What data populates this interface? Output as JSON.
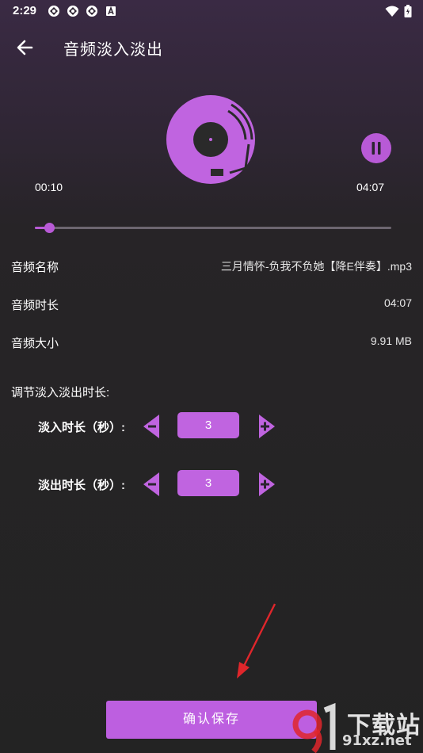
{
  "statusbar": {
    "time": "2:29",
    "icons": [
      "app-notification-icon",
      "app-notification-icon",
      "app-notification-icon",
      "font-a-icon"
    ],
    "right_icons": [
      "wifi-icon",
      "battery-icon"
    ]
  },
  "header": {
    "title": "音频淡入淡出",
    "back_icon": "back-arrow-icon"
  },
  "player": {
    "current_time": "00:10",
    "total_time": "04:07",
    "progress": 0.04,
    "pause_icon": "pause-icon",
    "disc_icon": "vinyl-record-icon"
  },
  "info": [
    {
      "label": "音频名称",
      "value": "三月情怀-负我不负她【降E伴奏】.mp3"
    },
    {
      "label": "音频时长",
      "value": "04:07"
    },
    {
      "label": "音频大小",
      "value": "9.91 MB"
    }
  ],
  "adjust": {
    "section_label": "调节淡入淡出时长:",
    "fade_in": {
      "label": "淡入时长（秒）:",
      "value": "3"
    },
    "fade_out": {
      "label": "淡出时长（秒）:",
      "value": "3"
    }
  },
  "actions": {
    "save_label": "确认保存"
  },
  "watermark": {
    "text_cn": "下载站",
    "text_en": "91xz.net"
  },
  "colors": {
    "accent": "#bd5fe0",
    "arrow": "#e0262b",
    "background": "#232323"
  }
}
